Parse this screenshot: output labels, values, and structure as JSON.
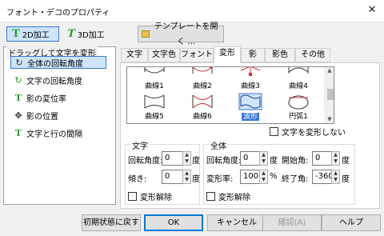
{
  "window": {
    "title": "フォント・デコのプロパティ",
    "close": "✕"
  },
  "modes": {
    "2d": "2D加工",
    "3d": "3D加工"
  },
  "template_button": "テンプレートを開く ...",
  "left_panel": {
    "title": "ドラッグして文字を変形",
    "items": [
      {
        "label": "全体の回転角度",
        "icon": "rotate-icon",
        "glyph": "↻"
      },
      {
        "label": "文字の回転角度",
        "icon": "char-rotate-icon",
        "glyph": "↻"
      },
      {
        "label": "影の変位率",
        "icon": "shadow-ratio-icon",
        "glyph": "T"
      },
      {
        "label": "影の位置",
        "icon": "shadow-position-icon",
        "glyph": "✥"
      },
      {
        "label": "文字と行の間隔",
        "icon": "spacing-icon",
        "glyph": "T"
      }
    ]
  },
  "tabs": [
    "文字",
    "文字色",
    "フォント",
    "変形",
    "影",
    "影色",
    "その他"
  ],
  "active_tab": "変形",
  "gallery": {
    "items": [
      {
        "label": "曲線1"
      },
      {
        "label": "曲線2"
      },
      {
        "label": "曲線3"
      },
      {
        "label": "曲線4"
      },
      {
        "label": "曲線5"
      },
      {
        "label": "曲線6"
      },
      {
        "label": "波形"
      },
      {
        "label": "円弧1"
      }
    ],
    "selected": "波形"
  },
  "no_deform_checkbox": "文字を変形しない",
  "text_group": {
    "title": "文字",
    "rotation_label": "回転角度:",
    "rotation_value": "0",
    "rotation_unit": "度",
    "slant_label": "傾き:",
    "slant_value": "0",
    "slant_unit": "度",
    "release_label": "変形解除"
  },
  "whole_group": {
    "title": "全体",
    "rotation_label": "回転角度:",
    "rotation_value": "0",
    "rotation_unit": "度",
    "start_label": "開始角:",
    "start_value": "0",
    "start_unit": "度",
    "ratio_label": "変形率:",
    "ratio_value": "100",
    "ratio_unit": "%",
    "end_label": "終了角:",
    "end_value": "-360",
    "end_unit": "度",
    "release_label": "変形解除"
  },
  "buttons": {
    "reset": "初期状態に戻す",
    "ok": "OK",
    "cancel": "キャンセル",
    "confirm": "確認(A)",
    "help": "ヘルプ"
  },
  "colors": {
    "accent": "#3a78d8",
    "selection_bg": "#cde4fb",
    "icon_green": "#2e9b3a",
    "marker_red": "#d03030"
  }
}
